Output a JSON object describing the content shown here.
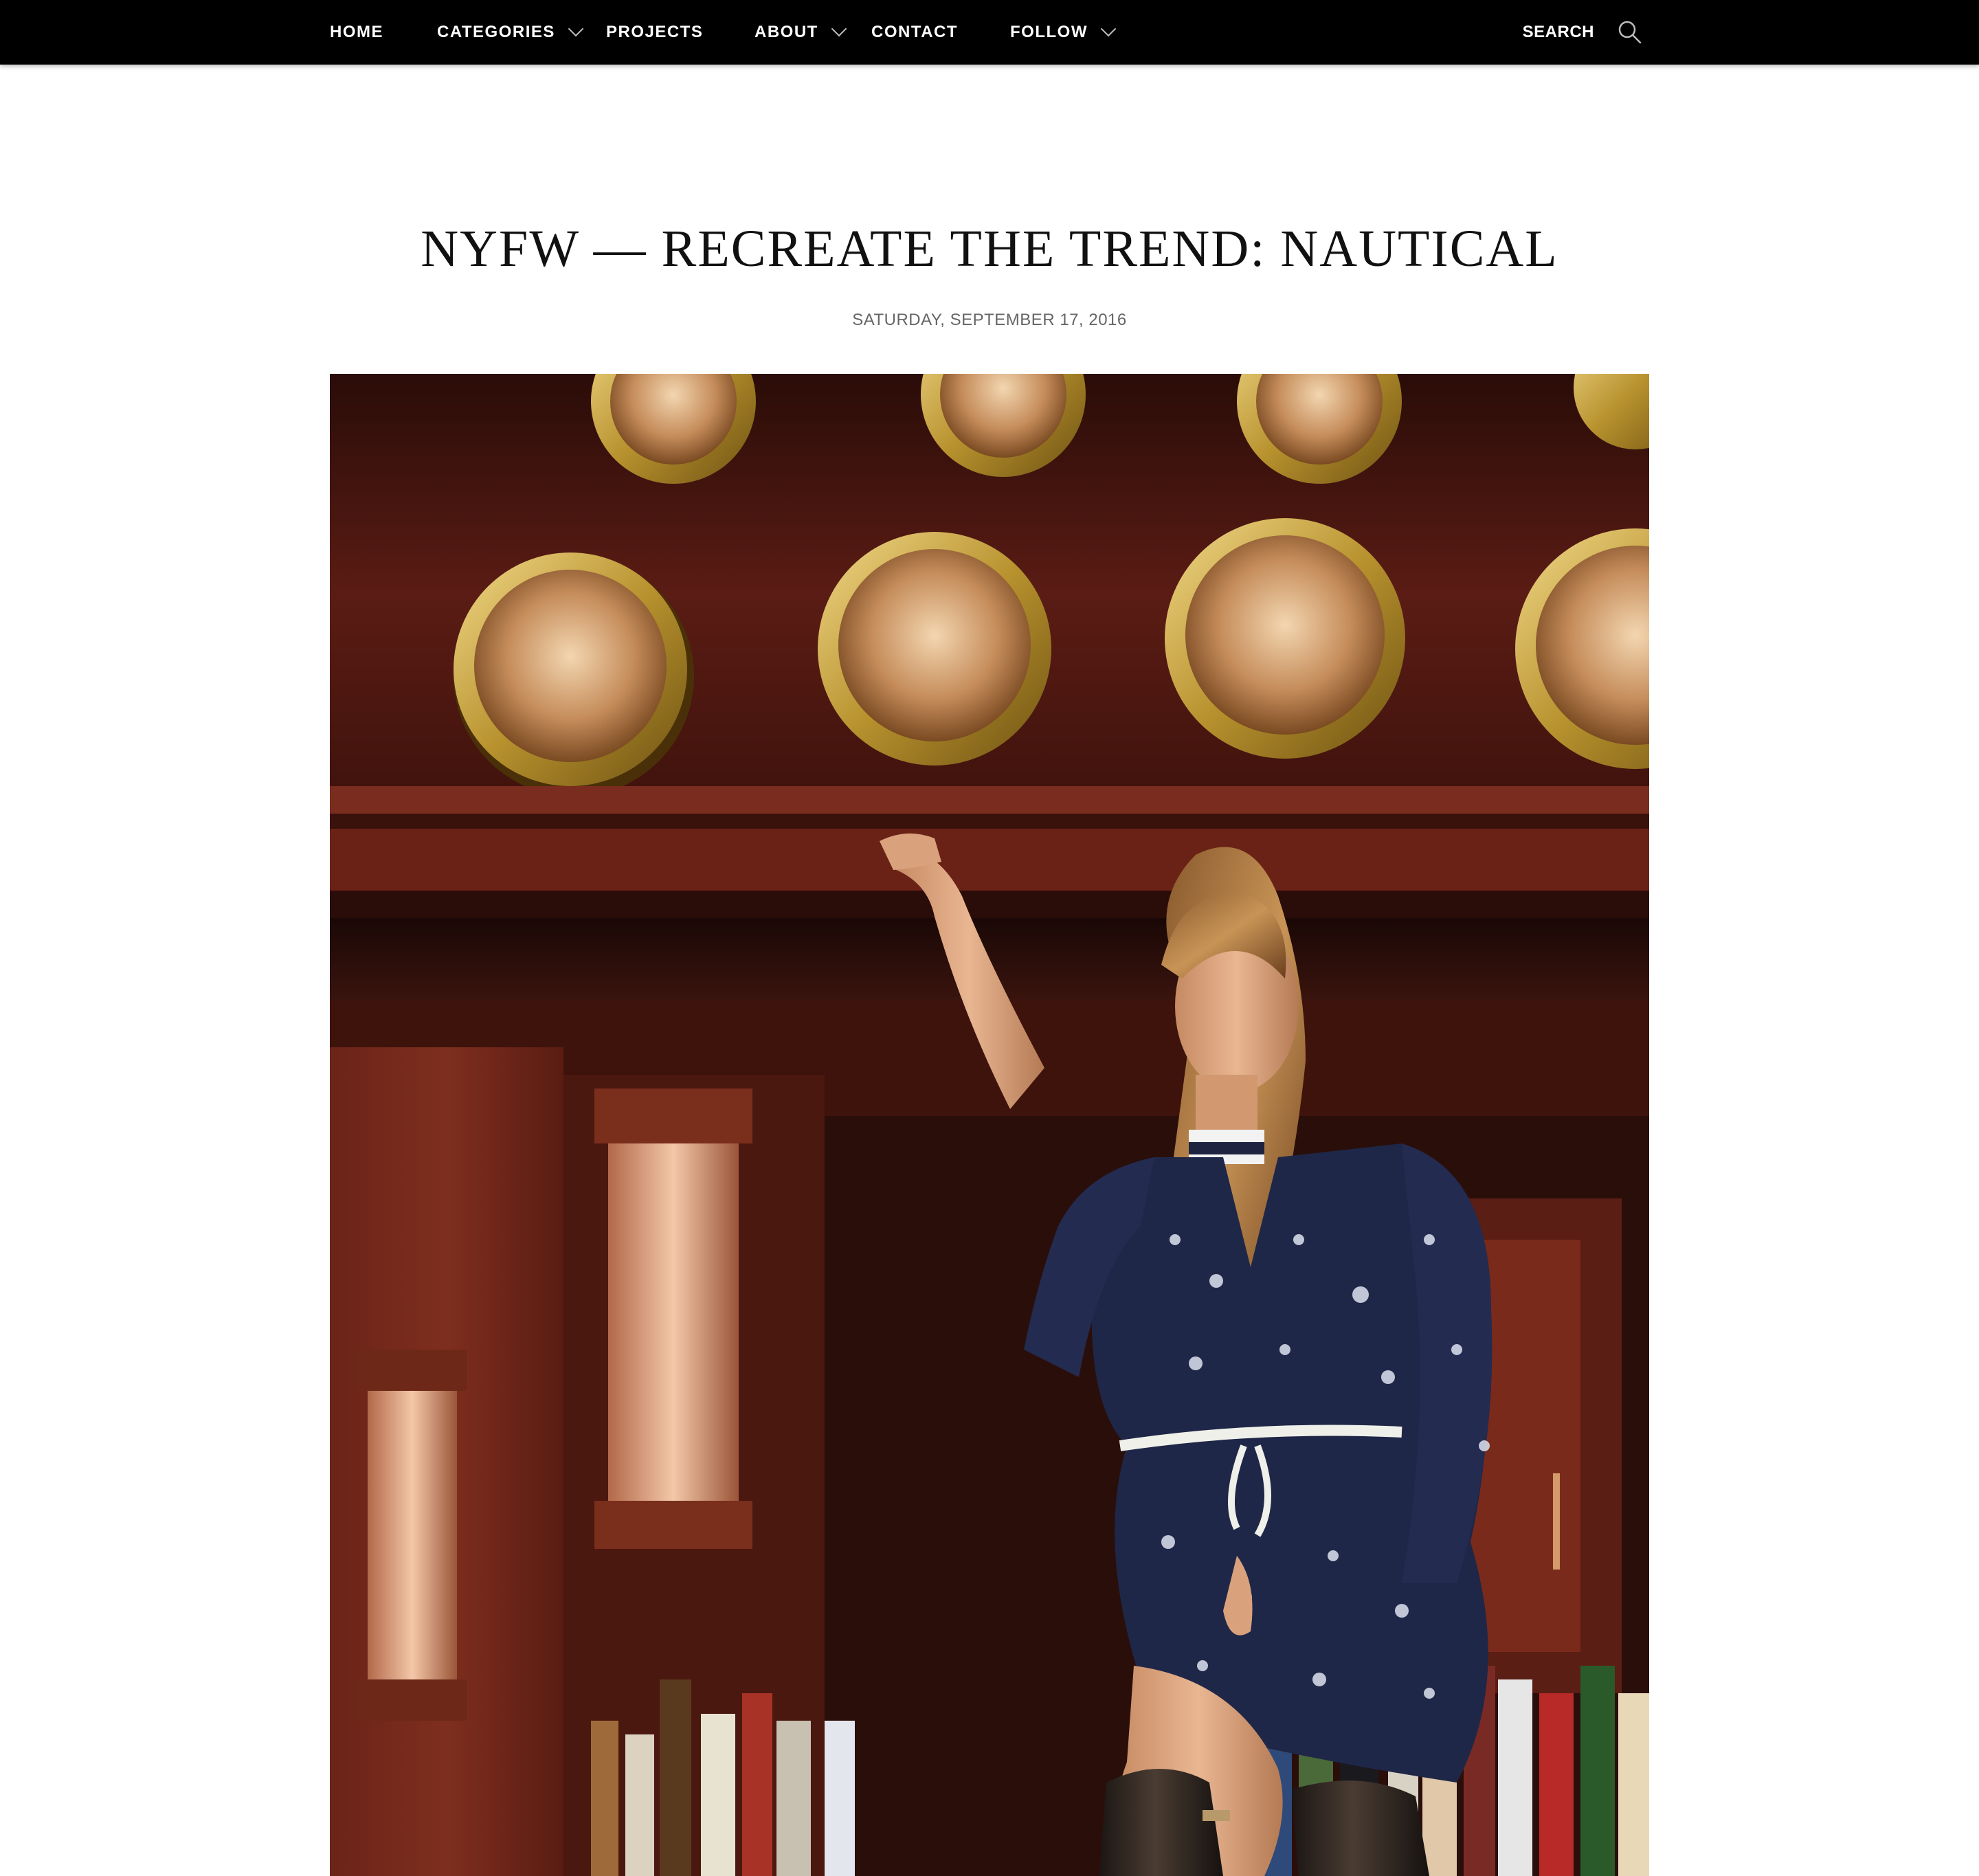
{
  "nav": {
    "items": [
      {
        "label": "HOME"
      },
      {
        "label": "CATEGORIES"
      },
      {
        "label": "PROJECTS"
      },
      {
        "label": "ABOUT"
      },
      {
        "label": "CONTACT"
      },
      {
        "label": "FOLLOW"
      }
    ],
    "search_label": "SEARCH",
    "search_icon": "magnifier-icon"
  },
  "post": {
    "title": "NYFW — RECREATE THE TREND: NAUTICAL",
    "date": "SATURDAY, SEPTEMBER 17, 2016"
  },
  "hero_image": {
    "subject": "model in navy star-print dress and tall leather boots standing on a wood bar with brass porthole lamps and liquor bottles"
  },
  "colors": {
    "nav_bg": "#000000",
    "nav_text": "#ffffff",
    "title": "#111111",
    "date": "#666666"
  }
}
